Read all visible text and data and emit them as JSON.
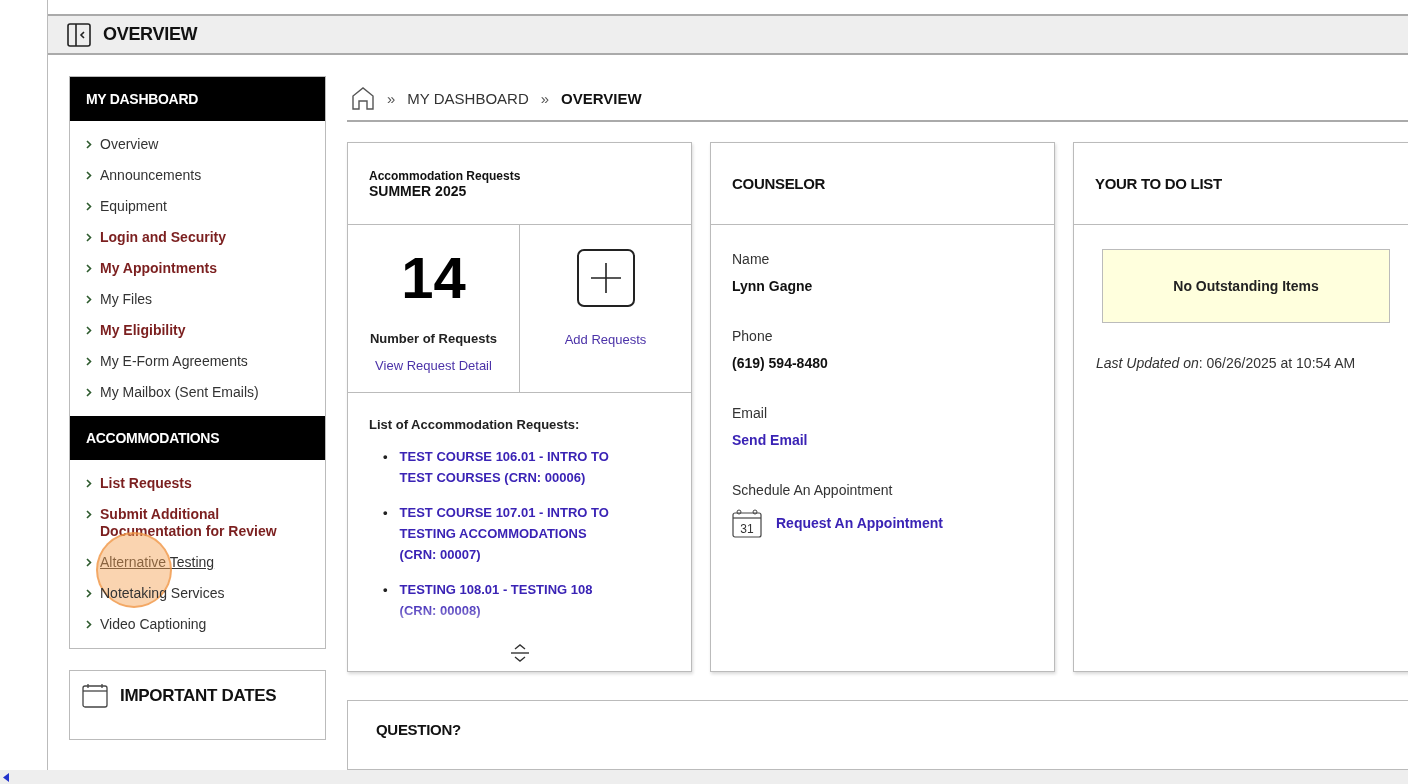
{
  "header": {
    "title": "OVERVIEW"
  },
  "sidebar": {
    "sections": [
      {
        "title": "MY DASHBOARD",
        "items": [
          {
            "label": "Overview",
            "kind": "plain",
            "hovered": false
          },
          {
            "label": "Announcements",
            "kind": "plain",
            "hovered": false
          },
          {
            "label": "Equipment",
            "kind": "plain",
            "hovered": false
          },
          {
            "label": "Login and Security",
            "kind": "emphasis",
            "hovered": false
          },
          {
            "label": "My Appointments",
            "kind": "emphasis",
            "hovered": false
          },
          {
            "label": "My Files",
            "kind": "plain",
            "hovered": false
          },
          {
            "label": "My Eligibility",
            "kind": "emphasis",
            "hovered": false
          },
          {
            "label": "My E-Form Agreements",
            "kind": "plain",
            "hovered": false
          },
          {
            "label": "My Mailbox (Sent Emails)",
            "kind": "plain",
            "hovered": false
          }
        ]
      },
      {
        "title": "ACCOMMODATIONS",
        "items": [
          {
            "label": "List Requests",
            "kind": "emphasis",
            "hovered": false
          },
          {
            "label": "Submit Additional Documentation for Review",
            "kind": "emphasis",
            "hovered": false
          },
          {
            "label": "Alternative Testing",
            "kind": "plain",
            "hovered": true
          },
          {
            "label": "Notetaking Services",
            "kind": "plain",
            "hovered": false
          },
          {
            "label": "Video Captioning",
            "kind": "plain",
            "hovered": false
          }
        ]
      }
    ]
  },
  "important_dates": {
    "title": "IMPORTANT DATES"
  },
  "breadcrumb": [
    {
      "separator": "»",
      "label": "MY DASHBOARD",
      "selected": false
    },
    {
      "separator": "»",
      "label": "OVERVIEW",
      "selected": true
    }
  ],
  "requests_card": {
    "title": "Accommodation Requests",
    "term": "SUMMER 2025",
    "count": "14",
    "count_label": "Number of Requests",
    "detail_link": "View Request Detail",
    "add_label": "Add Requests",
    "list_title": "List of Accommodation Requests:",
    "requests": [
      {
        "bullet": "•",
        "label": "TEST COURSE 106.01 - INTRO TO TEST COURSES (CRN: 00006)"
      },
      {
        "bullet": "•",
        "label": "TEST COURSE 107.01 - INTRO TO TESTING ACCOMMODATIONS (CRN: 00007)"
      },
      {
        "bullet": "•",
        "label": "TESTING 108.01 - TESTING 108 (CRN: 00008)"
      }
    ]
  },
  "counselor": {
    "title": "COUNSELOR",
    "fields": [
      {
        "label": "Name",
        "value": "Lynn Gagne",
        "kind": "text"
      },
      {
        "label": "Phone",
        "value": "(619) 594-8480",
        "kind": "text"
      },
      {
        "label": "Email",
        "value": "Send Email",
        "kind": "link"
      }
    ],
    "schedule_label": "Schedule An Appointment",
    "calendar_day": "31",
    "appointment_link": "Request An Appointment"
  },
  "todo": {
    "title": "YOUR TO DO LIST",
    "notice": "No Outstanding Items",
    "updated_label": "Last Updated on",
    "updated_value": ": 06/26/2025 at 10:54 AM"
  },
  "question": {
    "title": "QUESTION?"
  }
}
